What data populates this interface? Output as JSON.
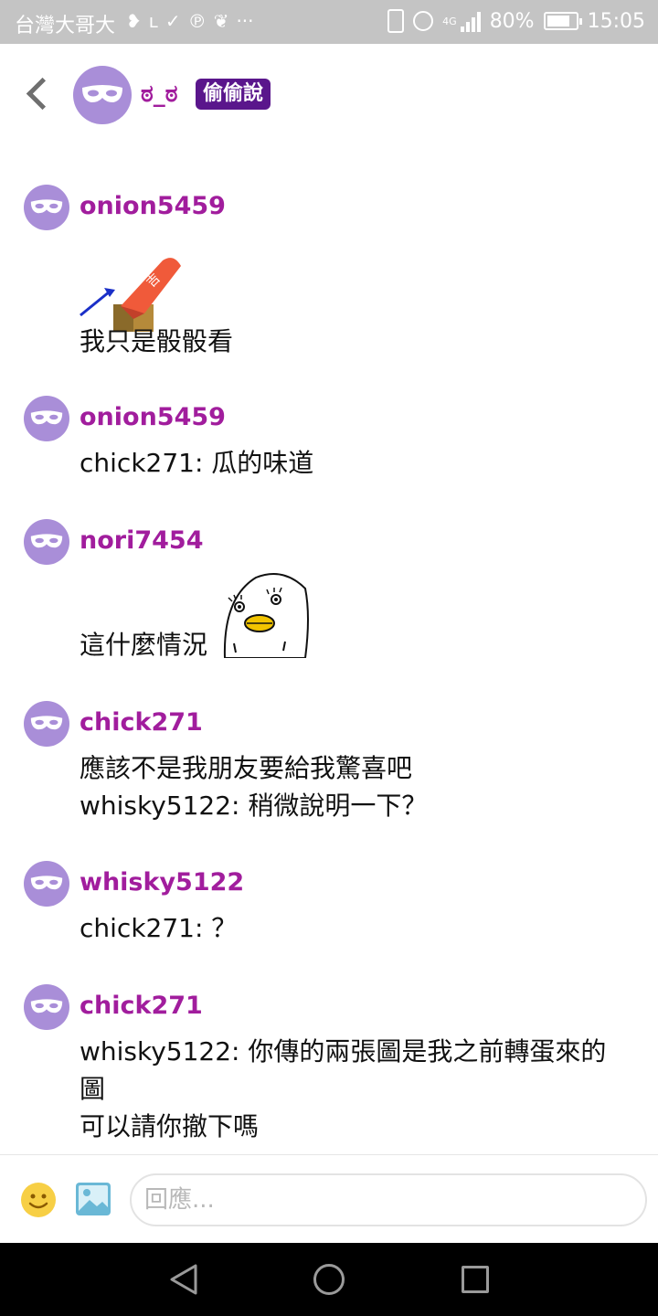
{
  "status_bar": {
    "carrier": "台灣大哥大",
    "notification_icons": [
      "chat-bubble-icon",
      "line-icon",
      "check-download-icon",
      "pinterest-icon",
      "twitter-icon",
      "more-icon"
    ],
    "notification_glyphs": [
      "❥",
      "ʟ",
      "✓",
      "℗",
      "❦",
      "···"
    ],
    "network": "4G",
    "battery": "80%",
    "battery_level": 0.8,
    "time": "15:05"
  },
  "header": {
    "back_icon": "chevron-left-icon",
    "avatar_icon": "mask-icon",
    "display_name": "ಠ_ಠ",
    "badge": "偷偷說",
    "colors": {
      "name": "#a11d9d",
      "badge_bg": "#5a168c",
      "avatar": "#a98ed8"
    }
  },
  "messages": [
    {
      "username": "onion5459",
      "lines": [
        "我只是骰骰看"
      ],
      "sticker": "pencil-sticker"
    },
    {
      "username": "onion5459",
      "lines": [
        "chick271: 瓜的味道"
      ]
    },
    {
      "username": "nori7454",
      "lines": [
        "這什麼情況"
      ],
      "sticker": "duck-face-sticker"
    },
    {
      "username": "chick271",
      "lines": [
        "應該不是我朋友要給我驚喜吧",
        "whisky5122: 稍微說明一下？"
      ]
    },
    {
      "username": "whisky5122",
      "lines": [
        "chick271: ？"
      ]
    },
    {
      "username": "chick271",
      "lines": [
        "whisky5122: 你傳的兩張圖是我之前轉蛋來的",
        "圖",
        "可以請你撤下嗎"
      ]
    }
  ],
  "input_bar": {
    "emoji_icon": "smiley-icon",
    "image_icon": "image-icon",
    "placeholder": "回應..."
  },
  "nav_bar": {
    "icons": [
      "triangle-back-icon",
      "circle-home-icon",
      "square-recents-icon"
    ]
  }
}
